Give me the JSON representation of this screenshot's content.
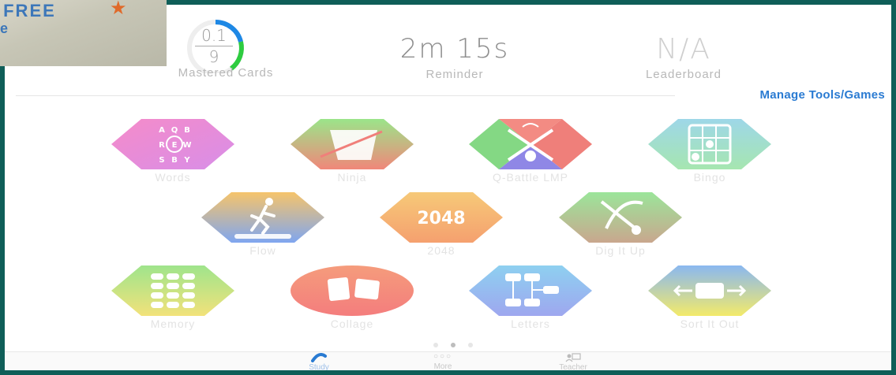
{
  "photo": {
    "text": " FREE",
    "line2": "e"
  },
  "stats": {
    "mastered": {
      "numerator": "0.1",
      "denominator": "9",
      "caption": "Mastered Cards"
    },
    "reminder": {
      "value": "2m 15s",
      "caption": "Reminder"
    },
    "leaderboard": {
      "value": "N/A",
      "caption": "Leaderboard"
    }
  },
  "manage_link": "Manage Tools/Games",
  "tiles": [
    {
      "label": "Words"
    },
    {
      "label": "Ninja"
    },
    {
      "label": "Q-Battle LMP"
    },
    {
      "label": "Bingo"
    },
    {
      "label": "Flow"
    },
    {
      "label": "2048"
    },
    {
      "label": "Dig It Up"
    },
    {
      "label": "Memory"
    },
    {
      "label": "Collage"
    },
    {
      "label": "Letters"
    },
    {
      "label": "Sort It Out"
    }
  ],
  "tile_glyphs": {
    "words": [
      "A",
      "Q",
      "B",
      "R",
      "E",
      "W",
      "S",
      "B",
      "Y"
    ],
    "game2048": "2048"
  },
  "tabs": [
    {
      "label": "Study"
    },
    {
      "label": "More"
    },
    {
      "label": "Teacher"
    }
  ],
  "colors": {
    "accent": "#2a7bd2",
    "ring_blue": "#1e88e5",
    "ring_green": "#2ecc40",
    "frame": "#0f5e58"
  }
}
